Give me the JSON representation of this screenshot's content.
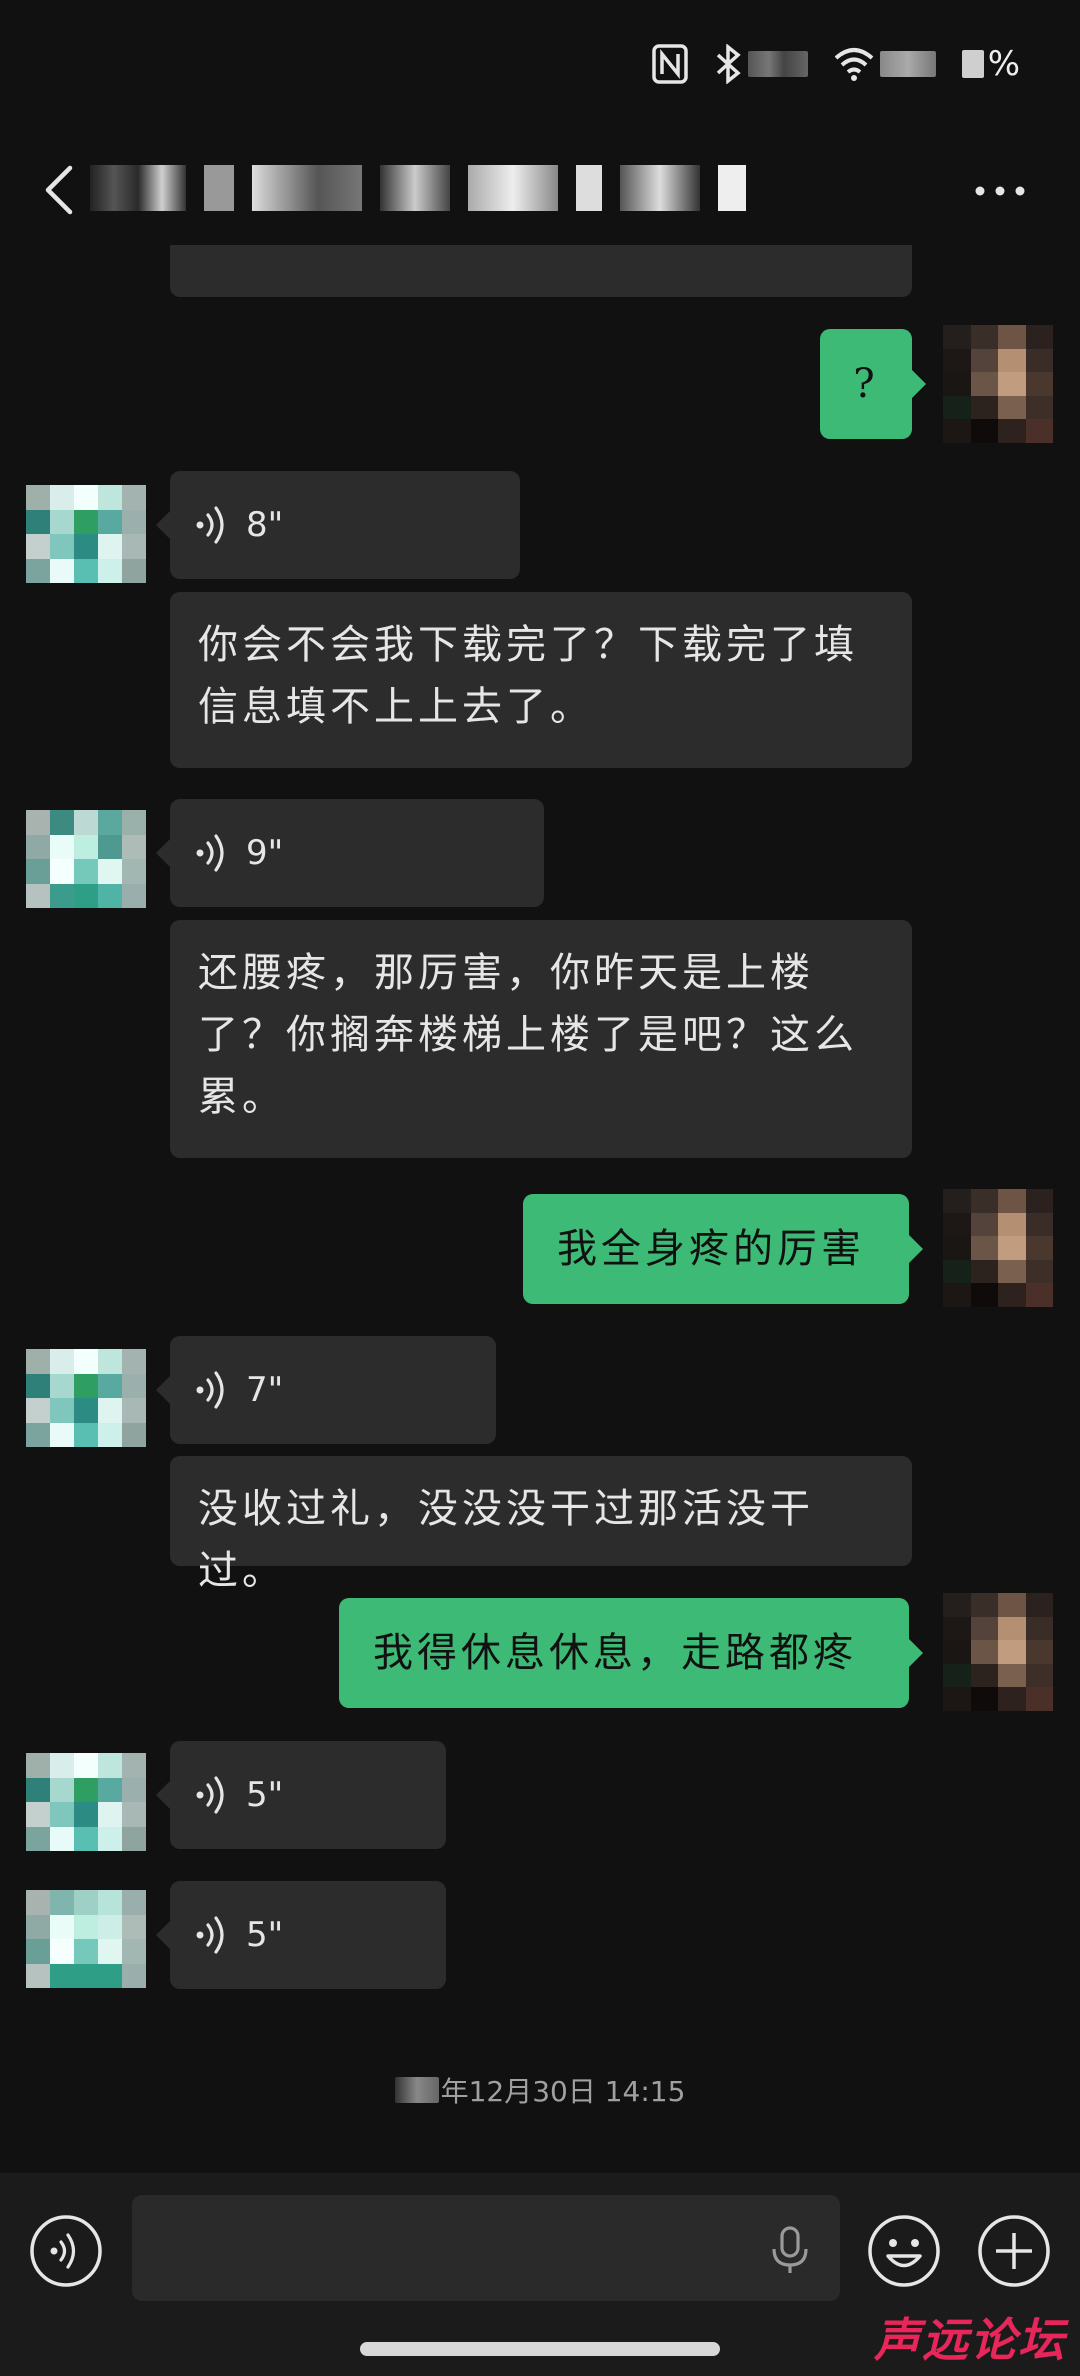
{
  "status_bar": {
    "nfc_icon": "nfc-icon",
    "bluetooth_icon": "bluetooth-icon",
    "wifi_icon": "wifi-icon",
    "battery_suffix": "%"
  },
  "header": {
    "back_icon": "chevron-left-icon",
    "more_icon": "more-dots-icon"
  },
  "messages": [
    {
      "side": "in",
      "type": "text",
      "text": ""
    },
    {
      "side": "out",
      "type": "text",
      "text": "?"
    },
    {
      "side": "in",
      "type": "voice",
      "duration": "8\""
    },
    {
      "side": "in",
      "type": "text",
      "text": "你会不会我下载完了？下载完了填信息填不上上去了。"
    },
    {
      "side": "in",
      "type": "voice",
      "duration": "9\""
    },
    {
      "side": "in",
      "type": "text",
      "text": "还腰疼，那厉害，你昨天是上楼了？你搁奔楼梯上楼了是吧？这么累。"
    },
    {
      "side": "out",
      "type": "text",
      "text": "我全身疼的厉害"
    },
    {
      "side": "in",
      "type": "voice",
      "duration": "7\""
    },
    {
      "side": "in",
      "type": "text",
      "text": "没收过礼，没没没干过那活没干过。"
    },
    {
      "side": "out",
      "type": "text",
      "text": "我得休息休息，走路都疼"
    },
    {
      "side": "in",
      "type": "voice",
      "duration": "5\""
    },
    {
      "side": "in",
      "type": "voice",
      "duration": "5\""
    }
  ],
  "timestamp": {
    "text": "年12月30日 14:15"
  },
  "input_bar": {
    "voice_toggle_icon": "voice-toggle-icon",
    "mic_icon": "microphone-icon",
    "emoji_icon": "emoji-icon",
    "plus_icon": "plus-icon",
    "input_value": "",
    "input_placeholder": ""
  },
  "watermark": {
    "text": "声远论坛"
  },
  "colors": {
    "background": "#111111",
    "incoming_bubble": "#2c2c2c",
    "outgoing_bubble": "#3dbb76",
    "watermark": "#e8265a"
  }
}
